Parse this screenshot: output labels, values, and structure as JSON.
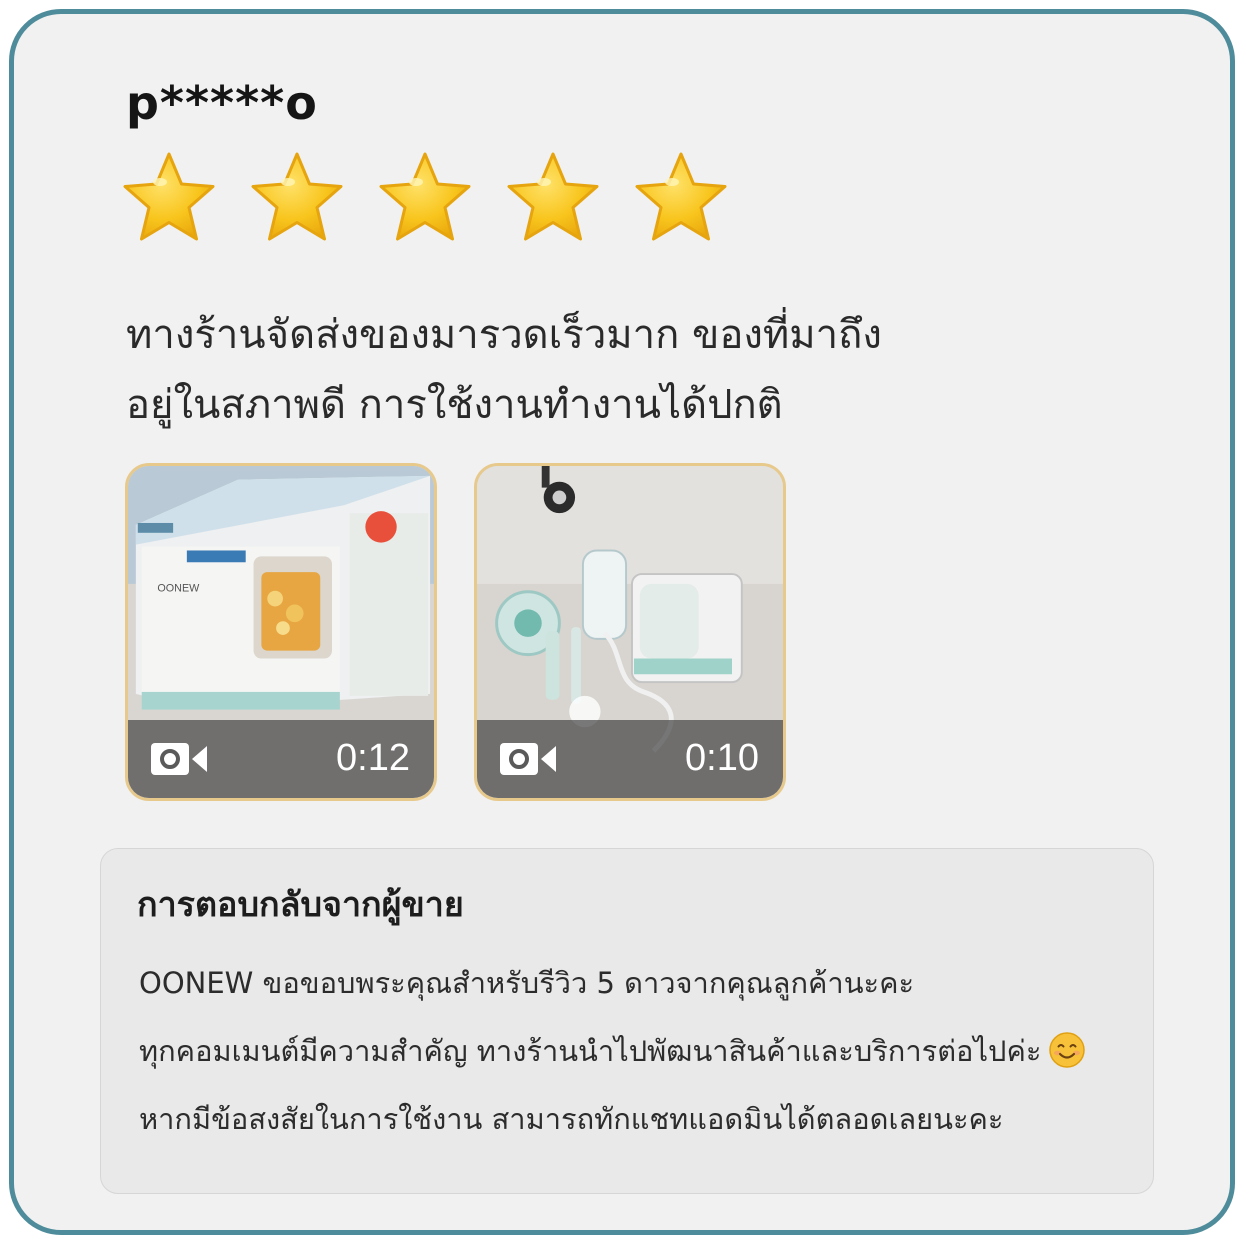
{
  "review": {
    "username": "p*****o",
    "rating": 5,
    "max_rating": 5,
    "star_icon": "star-icon",
    "star_color": "#f6c21c",
    "text_lines": [
      "ทางร้านจัดส่งของมารวดเร็วมาก ของที่มาถึง",
      "อยู่ในสภาพดี การใช้งานทำงานได้ปกติ"
    ],
    "media": [
      {
        "type": "video",
        "duration": "0:12",
        "icon": "video-camera-icon",
        "subject": "OONEW boxed product"
      },
      {
        "type": "video",
        "duration": "0:10",
        "icon": "video-camera-icon",
        "subject": "unboxed blender parts on floor"
      }
    ]
  },
  "seller_reply": {
    "title": "การตอบกลับจากผู้ขาย",
    "lines": [
      "OONEW ขอขอบพระคุณสำหรับรีวิว 5 ดาวจากคุณลูกค้านะคะ",
      "ทุกคอมเมนต์มีความสำคัญ ทางร้านนำไปพัฒนาสินค้าและบริการต่อไปค่ะ",
      "หากมีข้อสงสัยในการใช้งาน สามารถทักแชทแอดมินได้ตลอดเลยนะคะ"
    ],
    "emoji": "smiling-face-icon"
  },
  "colors": {
    "frame_border": "#4f8c9b",
    "card_background": "#f1f1f1",
    "reply_background": "#e9e9e9",
    "thumb_border": "#e7c98c"
  }
}
